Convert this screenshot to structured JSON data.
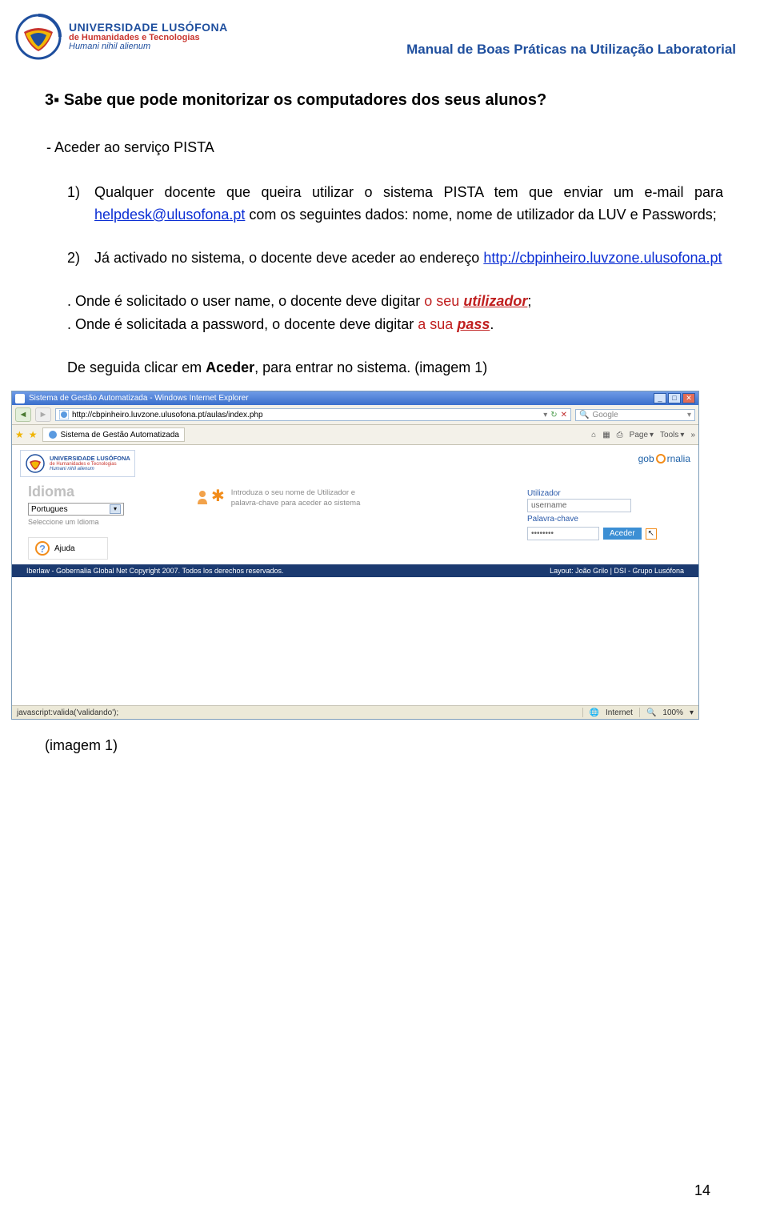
{
  "header": {
    "logo": {
      "line1": "UNIVERSIDADE LUSÓFONA",
      "line2": "de Humanidades e Tecnologias",
      "line3": "Humani nihil alienum"
    },
    "right": "Manual de Boas Práticas na Utilização Laboratorial"
  },
  "section": {
    "title": "3▪ Sabe que pode monitorizar os computadores dos seus alunos?",
    "subtitle": "- Aceder ao serviço PISTA",
    "item1_num": "1)",
    "item1_text_a": "Qualquer docente que queira utilizar o sistema PISTA tem que enviar um e-mail para ",
    "item1_link": "helpdesk@ulusofona.pt",
    "item1_text_b": " com os seguintes dados: nome, nome de utilizador da LUV e Passwords;",
    "item2_num": "2)",
    "item2_text_a": "Já activado no sistema, o docente deve aceder ao endereço ",
    "item2_link": "http://cbpinheiro.luvzone.ulusofona.pt",
    "note1_a": ". Onde é solicitado o user name, o docente deve digitar ",
    "note1_b": "o seu ",
    "note1_c": "utilizador",
    "note1_d": ";",
    "note2_a": ". Onde é solicitada a password, o docente deve digitar ",
    "note2_b": "a sua ",
    "note2_c": "pass",
    "note2_d": ".",
    "final_a": "De seguida clicar em ",
    "final_b": "Aceder",
    "final_c": ", para entrar no sistema. (imagem 1)"
  },
  "browser": {
    "title": "Sistema de Gestão Automatizada - Windows Internet Explorer",
    "url": "http://cbpinheiro.luvzone.ulusofona.pt/aulas/index.php",
    "search_placeholder": "Google",
    "tab": "Sistema de Gestão Automatizada",
    "tool_page": "Page",
    "tool_tools": "Tools",
    "brand": "gobernalia",
    "idioma_label": "Idioma",
    "idioma_value": "Portugues",
    "idioma_helper": "Seleccione um Idioma",
    "ajuda": "Ajuda",
    "intro_text": "Introduza o seu nome de Utilizador e palavra-chave para aceder ao sistema",
    "field_user_label": "Utilizador",
    "field_user_value": "username",
    "field_pass_label": "Palavra-chave",
    "field_pass_value": "••••••••",
    "aceder_btn": "Aceder",
    "footer_left": "Iberlaw - Gobernalia Global Net Copyright 2007. Todos los derechos reservados.",
    "footer_right": "Layout: João Grilo | DSI - Grupo Lusófona",
    "status_left": "javascript:valida('validando');",
    "status_internet": "Internet",
    "status_zoom": "100%"
  },
  "caption": "(imagem 1)",
  "page_num": "14",
  "icons": {
    "back": "◄",
    "fwd": "►",
    "refresh": "↻",
    "stop": "✕",
    "dropdown": "▾",
    "star": "★",
    "star_add": "✚",
    "home": "⌂",
    "print": "⎙",
    "feed": "▦",
    "mag": "🔍",
    "chevrons": "»",
    "min": "_",
    "max": "□",
    "close": "✕",
    "globe": "🌐",
    "cursor": "↖"
  }
}
